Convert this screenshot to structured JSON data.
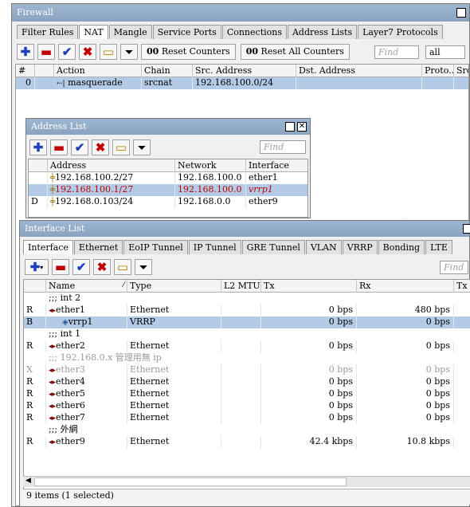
{
  "firewall": {
    "title": "Firewall",
    "tabs": [
      "Filter Rules",
      "NAT",
      "Mangle",
      "Service Ports",
      "Connections",
      "Address Lists",
      "Layer7 Protocols"
    ],
    "active_tab": "NAT",
    "reset_counters": "Reset Counters",
    "reset_all_counters": "Reset All Counters",
    "find_placeholder": "Find",
    "filter_value": "all",
    "columns": [
      "#",
      "Action",
      "Chain",
      "Src. Address",
      "Dst. Address",
      "Proto...",
      "Src"
    ],
    "rows": [
      {
        "num": "0",
        "action": "masquerade",
        "chain": "srcnat",
        "src": "192.168.100.0/24"
      }
    ]
  },
  "address_list": {
    "title": "Address List",
    "find_placeholder": "Find",
    "columns": [
      "Address",
      "Network",
      "Interface"
    ],
    "rows": [
      {
        "flag": "",
        "address": "192.168.100.2/27",
        "network": "192.168.100.0",
        "interface": "ether1"
      },
      {
        "flag": "",
        "address": "192.168.100.1/27",
        "network": "192.168.100.0",
        "interface": "vrrp1"
      },
      {
        "flag": "D",
        "address": "192.168.0.103/24",
        "network": "192.168.0.0",
        "interface": "ether9"
      }
    ]
  },
  "interface_list": {
    "title": "Interface List",
    "tabs": [
      "Interface",
      "Ethernet",
      "EoIP Tunnel",
      "IP Tunnel",
      "GRE Tunnel",
      "VLAN",
      "VRRP",
      "Bonding",
      "LTE"
    ],
    "active_tab": "Interface",
    "find_placeholder": "Find",
    "columns": [
      "Name",
      "Type",
      "L2 MTU",
      "Tx",
      "Rx",
      "Tx P"
    ],
    "rows": [
      {
        "kind": "comment",
        "text": ";;; int 2"
      },
      {
        "flag": "R",
        "name": "ether1",
        "type": "Ethernet",
        "tx": "0 bps",
        "rx": "480 bps"
      },
      {
        "flag": "B",
        "name": "vrrp1",
        "type": "VRRP",
        "tx": "0 bps",
        "rx": "0 bps",
        "selected": true,
        "indent": true
      },
      {
        "kind": "comment",
        "text": ";;; int 1"
      },
      {
        "flag": "R",
        "name": "ether2",
        "type": "Ethernet",
        "tx": "0 bps",
        "rx": "0 bps"
      },
      {
        "kind": "comment",
        "text": ";;; 192.168.0.x 管理用無 ip",
        "disabled": true
      },
      {
        "flag": "X",
        "name": "ether3",
        "type": "Ethernet",
        "tx": "0 bps",
        "rx": "0 bps",
        "disabled": true
      },
      {
        "flag": "R",
        "name": "ether4",
        "type": "Ethernet",
        "tx": "0 bps",
        "rx": "0 bps"
      },
      {
        "flag": "R",
        "name": "ether5",
        "type": "Ethernet",
        "tx": "0 bps",
        "rx": "0 bps"
      },
      {
        "flag": "R",
        "name": "ether6",
        "type": "Ethernet",
        "tx": "0 bps",
        "rx": "0 bps"
      },
      {
        "flag": "R",
        "name": "ether7",
        "type": "Ethernet",
        "tx": "0 bps",
        "rx": "0 bps"
      },
      {
        "kind": "comment",
        "text": ";;; 外網"
      },
      {
        "flag": "R",
        "name": "ether9",
        "type": "Ethernet",
        "tx": "42.4 kbps",
        "rx": "10.8 kbps"
      }
    ],
    "status": "9 items (1 selected)"
  },
  "colors": {
    "title_bar": "#8aa3c0",
    "selection": "#b3cbe6",
    "add": "#1f3fbf",
    "remove": "#c00000"
  }
}
